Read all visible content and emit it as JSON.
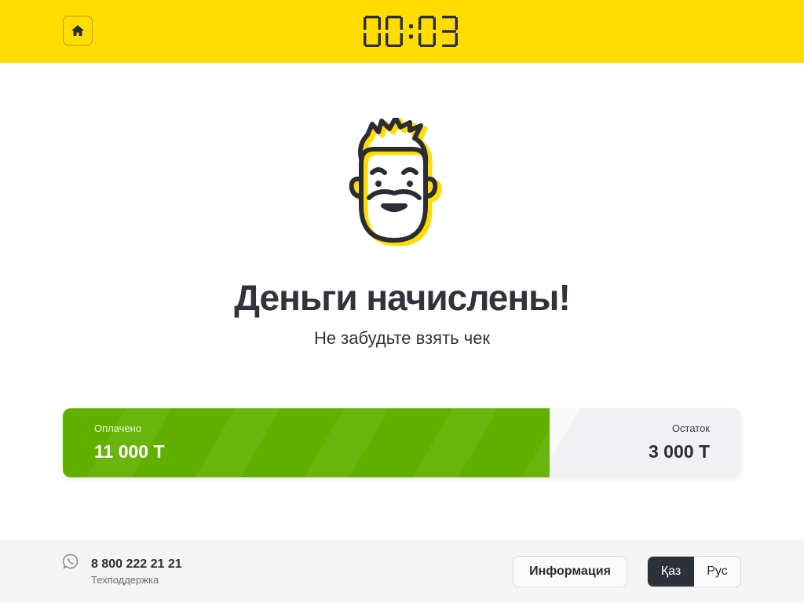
{
  "header": {
    "timer": {
      "minutes": "00",
      "seconds": "03"
    },
    "home_icon": "home-icon",
    "accent_color": "#ffdd00"
  },
  "main": {
    "mascot_icon": "bearded-man-mascot",
    "title": "Деньги начислены!",
    "subtitle": "Не забудьте взять чек"
  },
  "payment": {
    "paid_label": "Оплачено",
    "paid_value": "11 000 Т",
    "remaining_label": "Остаток",
    "remaining_value": "3 000 Т",
    "paid_fraction": 0.718,
    "paid_color": "#61b000"
  },
  "footer": {
    "phone_icon": "whatsapp-icon",
    "phone": "8 800 222 21 21",
    "support_label": "Техподдержка",
    "info_button": "Информация",
    "languages": [
      {
        "label": "Қаз",
        "active": true
      },
      {
        "label": "Рус",
        "active": false
      }
    ]
  }
}
